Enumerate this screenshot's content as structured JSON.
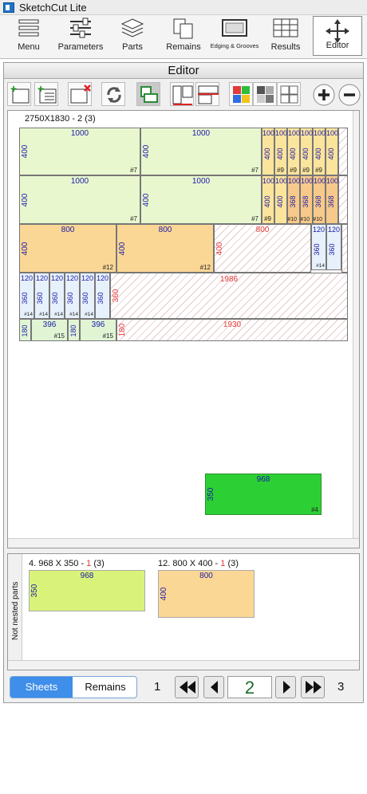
{
  "app": {
    "title": "SketchCut Lite"
  },
  "toolbar": {
    "items": [
      {
        "label": "Menu",
        "icon": "menu-icon"
      },
      {
        "label": "Parameters",
        "icon": "sliders-icon"
      },
      {
        "label": "Parts",
        "icon": "layers-icon"
      },
      {
        "label": "Remains",
        "icon": "remains-icon"
      },
      {
        "label": "Edging & Grooves",
        "icon": "edging-icon"
      },
      {
        "label": "Results",
        "icon": "table-icon"
      },
      {
        "label": "Editor",
        "icon": "move-icon"
      }
    ],
    "active": "Editor"
  },
  "editor": {
    "title": "Editor",
    "sheet_label": "2750X1830 - 2 (3)",
    "parts": [
      {
        "w": "1000",
        "h": "400",
        "id": "#7"
      },
      {
        "w": "1000",
        "h": "400",
        "id": "#7"
      },
      {
        "w": "100",
        "h": "400",
        "id": "#9"
      },
      {
        "w": "1000",
        "h": "400",
        "id": "#7"
      },
      {
        "w": "1000",
        "h": "400",
        "id": "#7"
      },
      {
        "w": "100",
        "h": "368",
        "id": "#10"
      },
      {
        "w": "800",
        "h": "400",
        "id": "#12"
      },
      {
        "w": "800",
        "h": "400",
        "id": "#12"
      },
      {
        "w": "800",
        "h": "400"
      },
      {
        "w": "120",
        "h": "360",
        "id": "#14"
      },
      {
        "w": "1986",
        "h": "360"
      },
      {
        "w": "396",
        "h": "180",
        "id": "#15"
      },
      {
        "w": "1930",
        "h": "180"
      },
      {
        "w": "968",
        "h": "350",
        "id": "#4"
      }
    ]
  },
  "not_nested": {
    "side_label": "Not nested parts",
    "cards": [
      {
        "title_prefix": "4. 968 X 350 - ",
        "count": "1",
        "total": " (3)",
        "w": "968",
        "h": "350"
      },
      {
        "title_prefix": "12. 800 X 400 - ",
        "count": "1",
        "total": " (3)",
        "w": "800",
        "h": "400"
      }
    ]
  },
  "bottom": {
    "tabs": [
      {
        "label": "Sheets",
        "active": true
      },
      {
        "label": "Remains",
        "active": false
      }
    ],
    "page_first": "1",
    "page_current": "2",
    "page_last": "3"
  },
  "colors": {
    "accent": "#3e8eea",
    "waste_text": "#e43a3a",
    "dim_text": "#1a1aa8",
    "current_page": "#1b6b2e"
  }
}
